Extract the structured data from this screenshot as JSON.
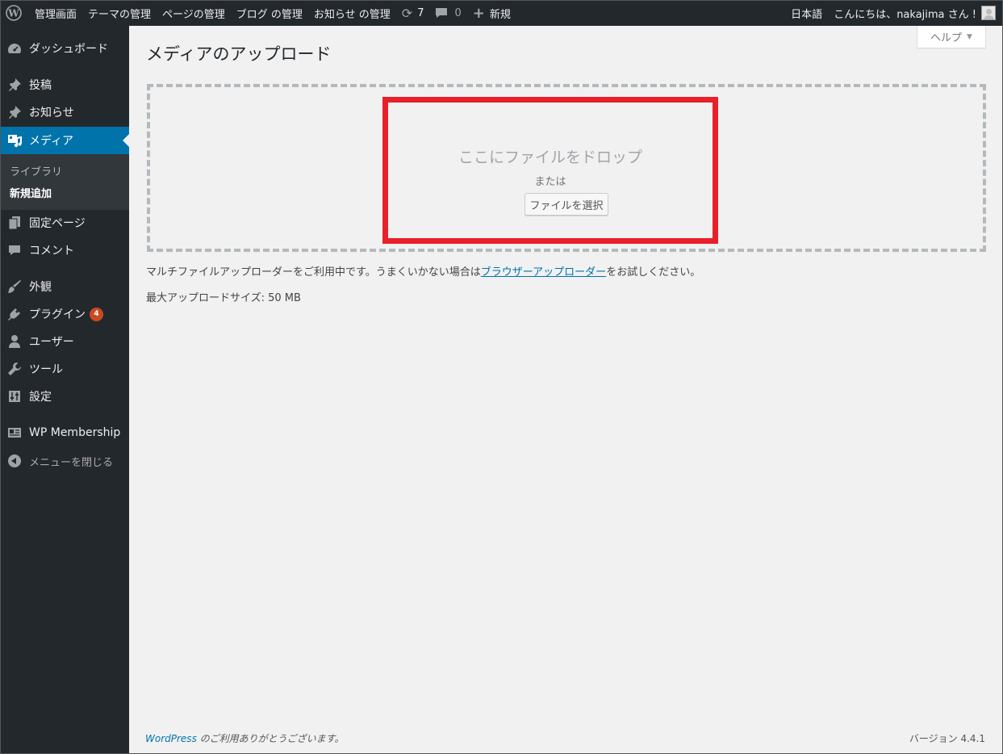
{
  "adminbar": {
    "site_label": "管理画面",
    "menu_theme": "テーマの管理",
    "menu_page": "ページの管理",
    "menu_blog": "ブログ の管理",
    "menu_news": "お知らせ の管理",
    "updates_count": "7",
    "comments_count": "0",
    "new_label": "新規",
    "language": "日本語",
    "greeting": "こんにちは、nakajima さん !"
  },
  "sidebar": {
    "dashboard": "ダッシュボード",
    "posts": "投稿",
    "news": "お知らせ",
    "media": "メディア",
    "media_sub": {
      "library": "ライブラリ",
      "add_new": "新規追加"
    },
    "pages": "固定ページ",
    "comments": "コメント",
    "appearance": "外観",
    "plugins": "プラグイン",
    "plugins_badge": "4",
    "users": "ユーザー",
    "tools": "ツール",
    "settings": "設定",
    "wp_membership": "WP Membership",
    "collapse": "メニューを閉じる"
  },
  "main": {
    "help_label": "ヘルプ",
    "title": "メディアのアップロード",
    "drop_text": "ここにファイルをドロップ",
    "or_text": "または",
    "select_button": "ファイルを選択",
    "info_prefix": "マルチファイルアップローダーをご利用中です。うまくいかない場合は",
    "info_link": "ブラウザーアップローダー",
    "info_suffix": "をお試しください。",
    "max_size": "最大アップロードサイズ: 50 MB"
  },
  "footer": {
    "wordpress_link": "WordPress",
    "thanks_text": " のご利用ありがとうございます。",
    "version": "バージョン 4.4.1"
  },
  "colors": {
    "adminbar_bg": "#23282d",
    "current_menu": "#0073aa",
    "highlight_border": "#e8202a",
    "badge": "#ca4a1f"
  }
}
